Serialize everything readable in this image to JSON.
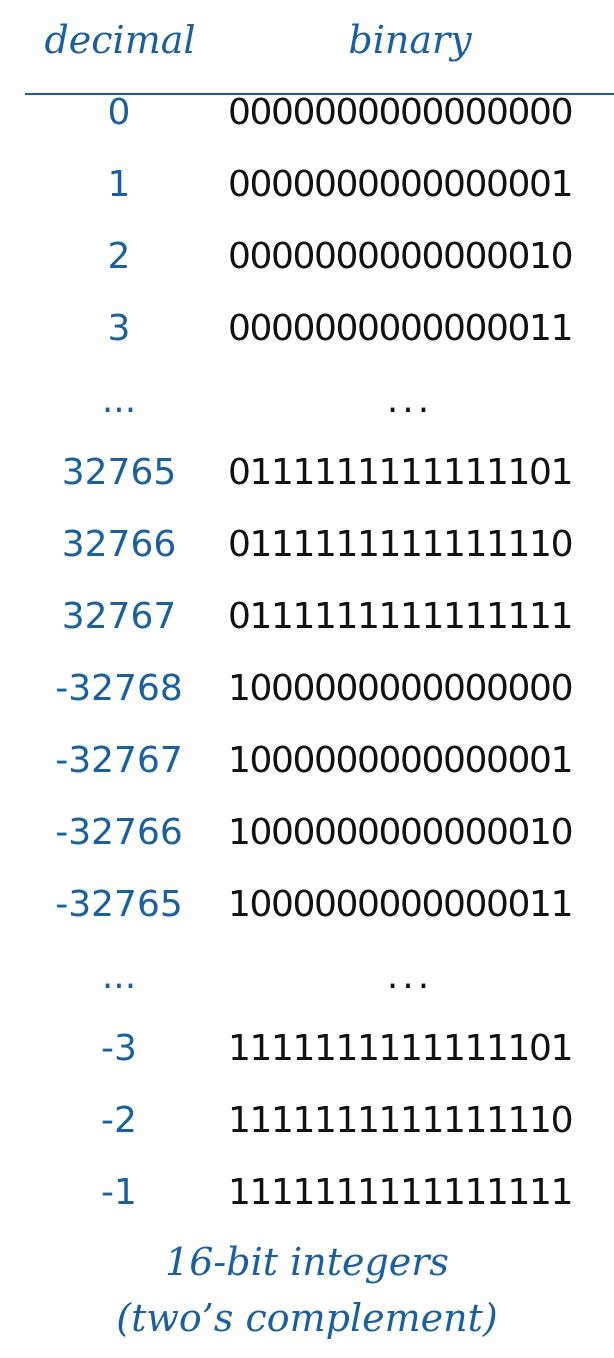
{
  "header": {
    "decimal_label": "decimal",
    "binary_label": "binary"
  },
  "rows": [
    {
      "decimal": "0",
      "binary": "0000000000000000"
    },
    {
      "decimal": "1",
      "binary": "0000000000000001"
    },
    {
      "decimal": "2",
      "binary": "0000000000000010"
    },
    {
      "decimal": "3",
      "binary": "0000000000000011"
    },
    {
      "decimal": "...",
      "binary": "..."
    },
    {
      "decimal": "32765",
      "binary": "0111111111111101"
    },
    {
      "decimal": "32766",
      "binary": "0111111111111110"
    },
    {
      "decimal": "32767",
      "binary": "0111111111111111"
    },
    {
      "decimal": "-32768",
      "binary": "1000000000000000"
    },
    {
      "decimal": "-32767",
      "binary": "1000000000000001"
    },
    {
      "decimal": "-32766",
      "binary": "1000000000000010"
    },
    {
      "decimal": "-32765",
      "binary": "1000000000000011"
    },
    {
      "decimal": "...",
      "binary": "..."
    },
    {
      "decimal": "-3",
      "binary": "1111111111111101"
    },
    {
      "decimal": "-2",
      "binary": "1111111111111110"
    },
    {
      "decimal": "-1",
      "binary": "1111111111111111"
    }
  ],
  "caption": {
    "line1": "16-bit integers",
    "line2": "(two’s complement)"
  },
  "colors": {
    "accent": "#1a5f9e",
    "text": "#111111"
  }
}
